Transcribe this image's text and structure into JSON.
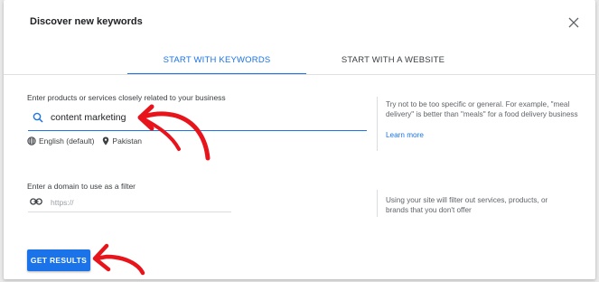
{
  "dialog": {
    "title": "Discover new keywords",
    "close_icon": "close-icon"
  },
  "tabs": [
    {
      "label": "START WITH KEYWORDS",
      "active": true
    },
    {
      "label": "START WITH A WEBSITE",
      "active": false
    }
  ],
  "keywords_section": {
    "label": "Enter products or services closely related to your business",
    "search_icon": "search-icon",
    "value": "content marketing",
    "language": "English (default)",
    "location": "Pakistan",
    "hint": "Try not to be too specific or general. For example, \"meal delivery\" is better than \"meals\" for a food delivery business",
    "learn_more": "Learn more"
  },
  "domain_section": {
    "label": "Enter a domain to use as a filter",
    "link_icon": "link-icon",
    "placeholder": "https://",
    "hint": "Using your site will filter out services, products, or brands that you don't offer"
  },
  "actions": {
    "submit_label": "GET RESULTS"
  },
  "colors": {
    "accent": "#1a73e8",
    "annotation": "#e8141c",
    "text_primary": "#202124",
    "text_secondary": "#5f6368"
  }
}
